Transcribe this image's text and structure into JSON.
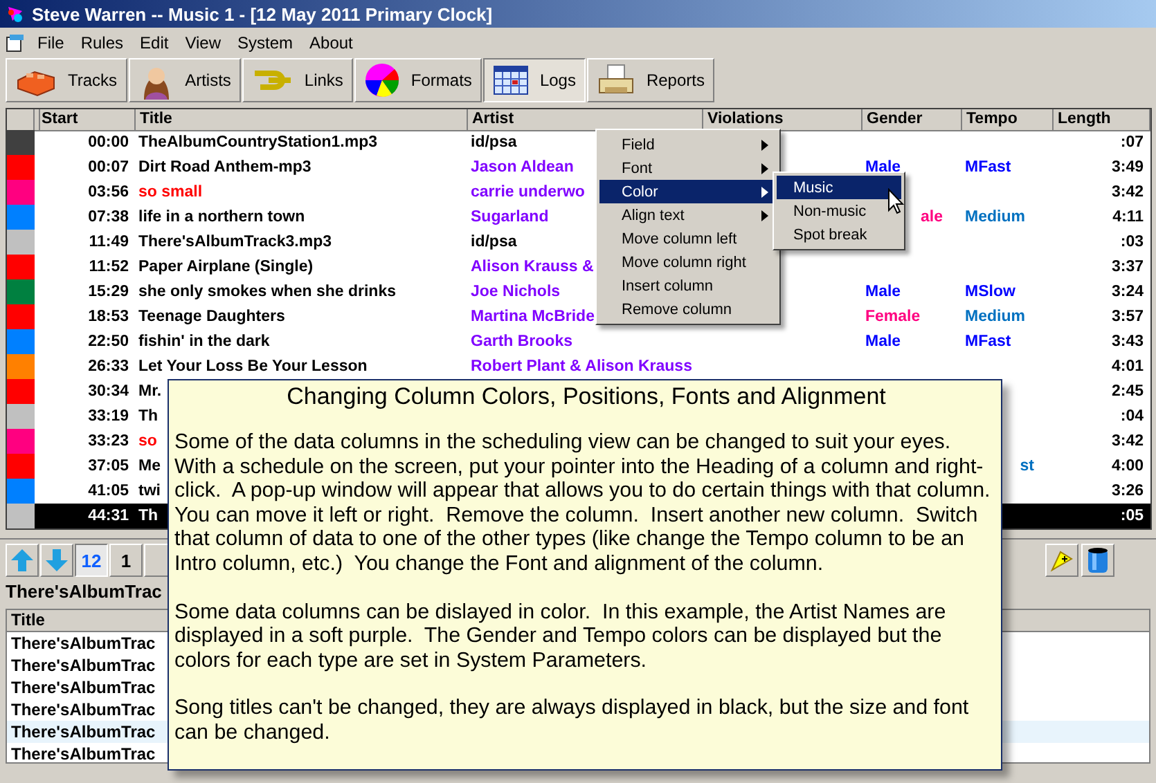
{
  "window": {
    "title": "Steve Warren -- Music 1 - [12 May 2011 Primary Clock]"
  },
  "menu": [
    "File",
    "Rules",
    "Edit",
    "View",
    "System",
    "About"
  ],
  "toolbar": [
    {
      "label": "Tracks",
      "kind": "brick",
      "selected": false
    },
    {
      "label": "Artists",
      "kind": "person",
      "selected": false
    },
    {
      "label": "Links",
      "kind": "link",
      "selected": false
    },
    {
      "label": "Formats",
      "kind": "pie",
      "selected": false
    },
    {
      "label": "Logs",
      "kind": "calendar",
      "selected": true
    },
    {
      "label": "Reports",
      "kind": "printer",
      "selected": false
    }
  ],
  "log": {
    "columns": [
      "Start",
      "Title",
      "Artist",
      "Violations",
      "Gender",
      "Tempo",
      "Length"
    ],
    "rows": [
      {
        "color": "#404040",
        "start": "00:00",
        "title": {
          "text": "TheAlbumCountryStation1.mp3",
          "color": "#000000"
        },
        "artist": {
          "text": "id/psa",
          "color": "#000000"
        },
        "length": ":07",
        "selected": false
      },
      {
        "color": "#ff0000",
        "start": "00:07",
        "title": {
          "text": "Dirt Road Anthem-mp3",
          "color": "#000000"
        },
        "artist": {
          "text": "Jason Aldean",
          "color": "#8000ff"
        },
        "gender": {
          "text": "Male",
          "color": "#0000ff"
        },
        "tempo": {
          "text": "MFast",
          "color": "#0000ff"
        },
        "length": "3:49",
        "selected": false
      },
      {
        "color": "#ff0080",
        "start": "03:56",
        "title": {
          "text": "so small",
          "color": "#ff0000"
        },
        "artist": {
          "text": "carrie underwo",
          "color": "#8000ff"
        },
        "length": "3:42",
        "selected": false
      },
      {
        "color": "#0080ff",
        "start": "07:38",
        "title": {
          "text": "life in a northern town",
          "color": "#000000"
        },
        "artist": {
          "text": "Sugarland",
          "color": "#8000ff"
        },
        "gender": {
          "text": "ale",
          "color": "#ff0080",
          "cut": true
        },
        "tempo": {
          "text": "Medium",
          "color": "#0070c0"
        },
        "length": "4:11",
        "selected": false
      },
      {
        "color": "#c0c0c0",
        "start": "11:49",
        "title": {
          "text": "There'sAlbumTrack3.mp3",
          "color": "#000000"
        },
        "artist": {
          "text": "id/psa",
          "color": "#000000"
        },
        "length": ":03",
        "selected": false
      },
      {
        "color": "#ff0000",
        "start": "11:52",
        "title": {
          "text": "Paper Airplane (Single)",
          "color": "#000000"
        },
        "artist": {
          "text": "Alison Krauss &",
          "color": "#8000ff"
        },
        "length": "3:37",
        "selected": false
      },
      {
        "color": "#008040",
        "start": "15:29",
        "title": {
          "text": "she only smokes when she drinks",
          "color": "#000000"
        },
        "artist": {
          "text": "Joe Nichols",
          "color": "#8000ff"
        },
        "gender": {
          "text": "Male",
          "color": "#0000ff"
        },
        "tempo": {
          "text": "MSlow",
          "color": "#0000ff"
        },
        "length": "3:24",
        "selected": false
      },
      {
        "color": "#ff0000",
        "start": "18:53",
        "title": {
          "text": "Teenage Daughters",
          "color": "#000000"
        },
        "artist": {
          "text": "Martina McBride",
          "color": "#8000ff"
        },
        "gender": {
          "text": "Female",
          "color": "#ff0080"
        },
        "tempo": {
          "text": "Medium",
          "color": "#0070c0"
        },
        "length": "3:57",
        "selected": false
      },
      {
        "color": "#0080ff",
        "start": "22:50",
        "title": {
          "text": "fishin' in the dark",
          "color": "#000000"
        },
        "artist": {
          "text": "Garth Brooks",
          "color": "#8000ff"
        },
        "gender": {
          "text": "Male",
          "color": "#0000ff"
        },
        "tempo": {
          "text": "MFast",
          "color": "#0000ff"
        },
        "length": "3:43",
        "selected": false
      },
      {
        "color": "#ff8000",
        "start": "26:33",
        "title": {
          "text": "Let Your Loss Be Your Lesson",
          "color": "#000000"
        },
        "artist": {
          "text": "Robert Plant & Alison Krauss",
          "color": "#8000ff"
        },
        "length": "4:01",
        "selected": false
      },
      {
        "color": "#ff0000",
        "start": "30:34",
        "title": {
          "text": "Mr.",
          "color": "#000000"
        },
        "length": "2:45",
        "selected": false
      },
      {
        "color": "#c0c0c0",
        "start": "33:19",
        "title": {
          "text": "Th",
          "color": "#000000"
        },
        "length": ":04",
        "selected": false
      },
      {
        "color": "#ff0080",
        "start": "33:23",
        "title": {
          "text": "so",
          "color": "#ff0000"
        },
        "length": "3:42",
        "selected": false
      },
      {
        "color": "#ff0000",
        "start": "37:05",
        "title": {
          "text": "Me",
          "color": "#000000"
        },
        "tempo": {
          "text": "st",
          "color": "#0070c0",
          "cut": true
        },
        "length": "4:00",
        "selected": false
      },
      {
        "color": "#0080ff",
        "start": "41:05",
        "title": {
          "text": "twi",
          "color": "#000000"
        },
        "length": "3:26",
        "selected": false
      },
      {
        "color": "#c0c0c0",
        "start": "44:31",
        "title": {
          "text": "Th",
          "color": "#ffffff"
        },
        "length": ":05",
        "selected": true
      }
    ]
  },
  "bottom": {
    "buttons": [
      {
        "kind": "up",
        "pressed": false
      },
      {
        "kind": "down",
        "pressed": false
      },
      {
        "kind": "text",
        "label": "12",
        "pressed": true
      },
      {
        "kind": "text",
        "label": "1",
        "pressed": false
      },
      {
        "kind": "blank",
        "pressed": false
      }
    ],
    "tools": [
      {
        "kind": "pencil"
      },
      {
        "kind": "bin"
      }
    ],
    "track": "There'sAlbumTrac",
    "table": {
      "columns": [
        "Title"
      ],
      "rows": [
        {
          "title": "There'sAlbumTrac",
          "selected": false
        },
        {
          "title": "There'sAlbumTrac",
          "selected": false
        },
        {
          "title": "There'sAlbumTrac",
          "selected": false
        },
        {
          "title": "There'sAlbumTrac",
          "selected": false
        },
        {
          "title": "There'sAlbumTrac",
          "selected": true
        },
        {
          "title": "There'sAlbumTrac",
          "selected": false
        }
      ]
    }
  },
  "context_menu": {
    "items": [
      {
        "label": "Field",
        "submenu": true,
        "selected": false
      },
      {
        "label": "Font",
        "submenu": true,
        "selected": false
      },
      {
        "label": "Color",
        "submenu": true,
        "selected": true
      },
      {
        "label": "Align text",
        "submenu": true,
        "selected": false
      },
      {
        "label": "Move column left",
        "submenu": false,
        "selected": false
      },
      {
        "label": "Move column right",
        "submenu": false,
        "selected": false
      },
      {
        "label": "Insert column",
        "submenu": false,
        "selected": false
      },
      {
        "label": "Remove column",
        "submenu": false,
        "selected": false
      }
    ],
    "submenu": [
      {
        "label": "Music",
        "selected": true
      },
      {
        "label": "Non-music",
        "selected": false
      },
      {
        "label": "Spot break",
        "selected": false
      }
    ]
  },
  "help": {
    "title": "Changing Column Colors, Positions, Fonts and Alignment",
    "paragraphs": [
      "Some of the data columns in the scheduling view can be changed to suit your eyes. With a schedule on the screen, put your pointer into the Heading of a column and right-click.  A pop-up window will appear that allows you to do certain things with that column.  You can move it left or right.  Remove the column.  Insert another new column.  Switch that column of data to one of the other types (like change the Tempo column to be an Intro column, etc.)  You change the Font and alignment of the column.",
      "Some data columns can be dislayed in color.  In this example, the Artist Names are displayed in a soft purple.  The Gender and Tempo colors can be displayed but the colors for each type are set in System Parameters.",
      "Song titles can't be changed, they are always displayed in black, but the size and font can be changed."
    ]
  }
}
